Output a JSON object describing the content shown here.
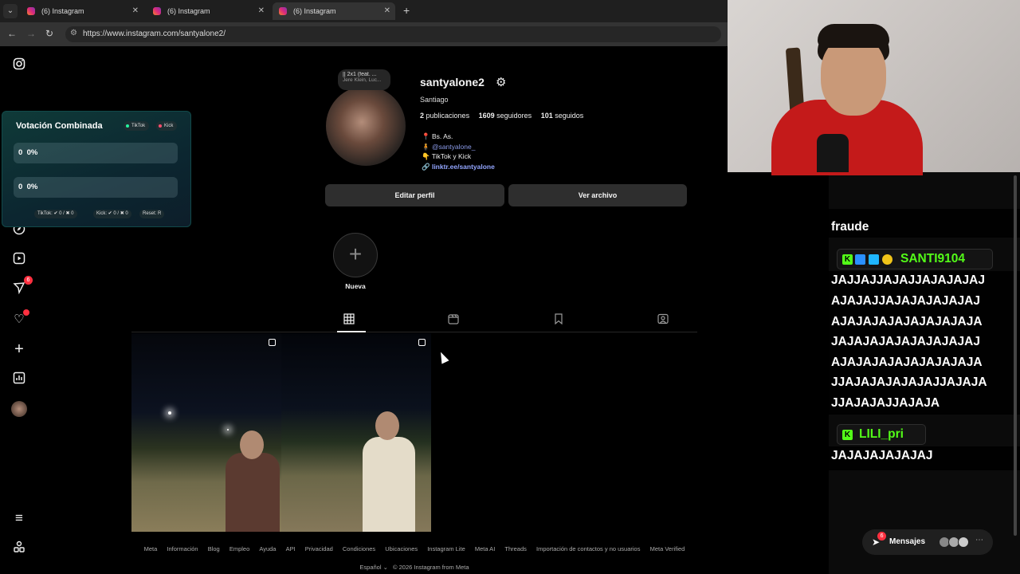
{
  "browser": {
    "tabs": [
      {
        "title": "(6) Instagram",
        "active": false
      },
      {
        "title": "(6) Instagram",
        "active": false
      },
      {
        "title": "(6) Instagram",
        "active": true
      }
    ],
    "new_tab": "+",
    "url": "https://www.instagram.com/santyalone2/"
  },
  "sidebar": {
    "icons": [
      "instagram-logo-icon",
      "home-icon",
      "search-icon",
      "explore-icon",
      "reels-icon",
      "messages-icon",
      "notifications-icon",
      "create-icon",
      "dashboard-icon",
      "profile-avatar",
      "menu-icon",
      "meta-threads-icon"
    ],
    "messages_badge": "6"
  },
  "profile": {
    "note_line1": "|| 2x1 (feat. ...",
    "note_line2": "Jere Klein, Luc...",
    "username": "santyalone2",
    "full_name": "Santiago",
    "posts_count": "2",
    "posts_label": "publicaciones",
    "followers_count": "1609",
    "followers_label": "seguidores",
    "following_count": "101",
    "following_label": "seguidos",
    "bio_line1": "📍 Bs. As.",
    "bio_mention": "@santyalone_",
    "bio_line3": "👇 TikTok y Kick",
    "bio_link": "linktr.ee/santyalone",
    "edit_button": "Editar perfil",
    "archive_button": "Ver archivo",
    "new_highlight": "Nueva"
  },
  "profile_tabs": [
    "posts-grid-icon",
    "reels-tab-icon",
    "saved-tab-icon",
    "tagged-tab-icon"
  ],
  "footer": {
    "links": [
      "Meta",
      "Información",
      "Blog",
      "Empleo",
      "Ayuda",
      "API",
      "Privacidad",
      "Condiciones",
      "Ubicaciones",
      "Instagram Lite",
      "Meta AI",
      "Threads",
      "Importación de contactos y no usuarios",
      "Meta Verified"
    ],
    "language": "Español",
    "copyright": "© 2026 Instagram from Meta"
  },
  "vote_widget": {
    "title": "Votación Combinada",
    "pill_tiktok": "TikTok",
    "pill_kick": "Kick",
    "bar1_count": "0",
    "bar1_pct": "0%",
    "bar1_fraction": 0,
    "bar2_count": "0",
    "bar2_pct": "0%",
    "bar2_fraction": 0,
    "foot_tiktok": "TikTok: ✔ 0 / ✖ 0",
    "foot_kick": "Kick: ✔ 0 / ✖ 0",
    "foot_reset": "Reset: R",
    "colors": {
      "tiktok": "#25f4a0",
      "kick": "#ff4d6d"
    }
  },
  "chat": {
    "partial_top": "fraude",
    "messages": [
      {
        "username": "SANTI9104",
        "lines": [
          "JAJJAJJAJAJJAJAJAJAJ",
          "AJAJAJJAJAJAJAJAJAJ",
          "AJAJAJAJAJAJAJAJAJA",
          "JAJAJAJAJAJAJAJAJAJ",
          "AJAJAJAJAJAJAJAJAJA",
          "JJAJAJAJAJAJAJJAJAJA",
          "JJAJAJAJJAJAJA"
        ]
      },
      {
        "username": "LILI_pri",
        "lines": [
          "JAJAJAJAJAJAJ"
        ]
      }
    ],
    "kick_color": "#53fc18"
  },
  "messages_pill": {
    "label": "Mensajes",
    "badge": "6"
  }
}
